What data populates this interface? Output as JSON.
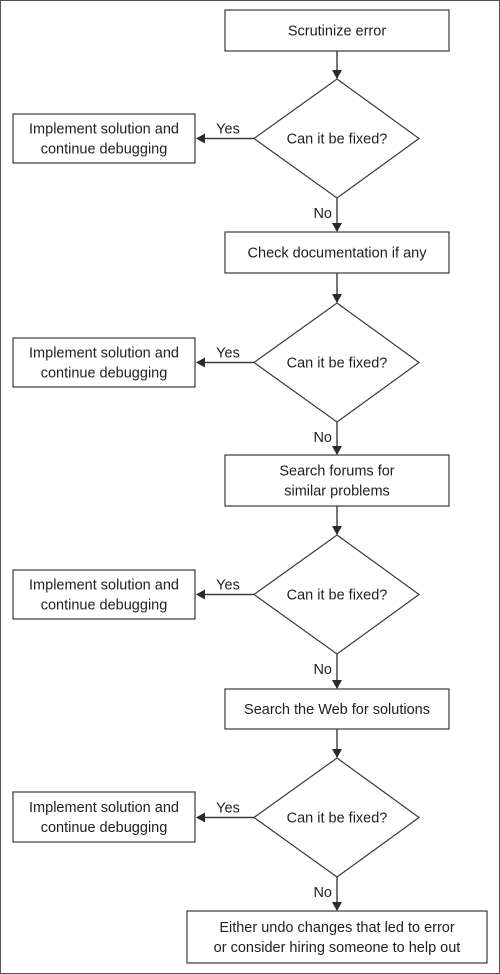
{
  "diagram": {
    "type": "flowchart",
    "colors": {
      "stroke": "#3a3a3a",
      "text": "#1f1f1f",
      "background": "#ffffff",
      "frame": "#555555"
    },
    "steps": [
      {
        "id": "step1",
        "lines": [
          "Scrutinize error"
        ]
      },
      {
        "id": "step2",
        "lines": [
          "Check documentation if any"
        ]
      },
      {
        "id": "step3",
        "lines": [
          "Search forums for",
          "similar problems"
        ]
      },
      {
        "id": "step4",
        "lines": [
          "Search the Web for solutions"
        ]
      },
      {
        "id": "final",
        "lines": [
          "Either undo changes that led to error",
          "or consider hiring someone to help out"
        ]
      }
    ],
    "decisions": [
      {
        "id": "decision1",
        "label": "Can it be fixed?"
      },
      {
        "id": "decision2",
        "label": "Can it be fixed?"
      },
      {
        "id": "decision3",
        "label": "Can it be fixed?"
      },
      {
        "id": "decision4",
        "label": "Can it be fixed?"
      }
    ],
    "outcomes": [
      {
        "id": "fix1",
        "lines": [
          "Implement solution and",
          "continue debugging"
        ]
      },
      {
        "id": "fix2",
        "lines": [
          "Implement solution and",
          "continue debugging"
        ]
      },
      {
        "id": "fix3",
        "lines": [
          "Implement solution and",
          "continue debugging"
        ]
      },
      {
        "id": "fix4",
        "lines": [
          "Implement solution and",
          "continue debugging"
        ]
      }
    ],
    "edge_labels": {
      "yes": "Yes",
      "no": "No"
    },
    "edges": [
      {
        "from": "step1",
        "to": "decision1",
        "label": ""
      },
      {
        "from": "decision1",
        "to": "fix1",
        "label": "Yes"
      },
      {
        "from": "decision1",
        "to": "step2",
        "label": "No"
      },
      {
        "from": "step2",
        "to": "decision2",
        "label": ""
      },
      {
        "from": "decision2",
        "to": "fix2",
        "label": "Yes"
      },
      {
        "from": "decision2",
        "to": "step3",
        "label": "No"
      },
      {
        "from": "step3",
        "to": "decision3",
        "label": ""
      },
      {
        "from": "decision3",
        "to": "fix3",
        "label": "Yes"
      },
      {
        "from": "decision3",
        "to": "step4",
        "label": "No"
      },
      {
        "from": "step4",
        "to": "decision4",
        "label": ""
      },
      {
        "from": "decision4",
        "to": "fix4",
        "label": "Yes"
      },
      {
        "from": "decision4",
        "to": "final",
        "label": "No"
      }
    ]
  }
}
